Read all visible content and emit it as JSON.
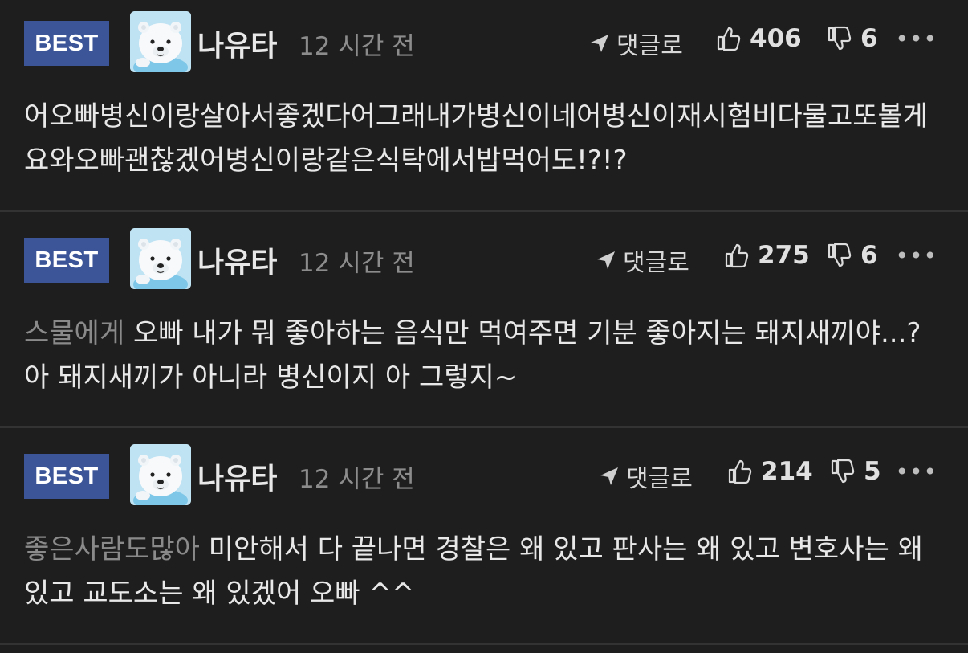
{
  "comments": [
    {
      "badge": "BEST",
      "username": "나유타",
      "time": "12 시간 전",
      "reply_label": "댓글로",
      "likes": "406",
      "dislikes": "6",
      "mention": "",
      "text": "어오빠병신이랑살아서좋겠다어그래내가병신이네어병신이재시험비다물고또볼게요와오빠괜찮겠어병신이랑같은식탁에서밥먹어도!?!?"
    },
    {
      "badge": "BEST",
      "username": "나유타",
      "time": "12 시간 전",
      "reply_label": "댓글로",
      "likes": "275",
      "dislikes": "6",
      "mention": "스물에게",
      "text": "오빠 내가 뭐 좋아하는 음식만 먹여주면 기분 좋아지는 돼지새끼야...? 아 돼지새끼가 아니라 병신이지 아 그렇지~"
    },
    {
      "badge": "BEST",
      "username": "나유타",
      "time": "12 시간 전",
      "reply_label": "댓글로",
      "likes": "214",
      "dislikes": "5",
      "mention": "좋은사람도많아",
      "text": "미안해서 다 끝나면 경찰은 왜 있고 판사는 왜 있고 변호사는 왜 있고 교도소는 왜 있겠어 오빠 ^^"
    }
  ],
  "icons": {
    "reply": "reply-arrow-icon",
    "like": "thumbs-up-icon",
    "dislike": "thumbs-down-icon",
    "more": "more-dots-icon",
    "avatar": "polar-bear-avatar"
  },
  "colors": {
    "background": "#1e1e1e",
    "best_badge": "#3b5598",
    "divider": "#333333",
    "muted_text": "#8a8a8a"
  }
}
